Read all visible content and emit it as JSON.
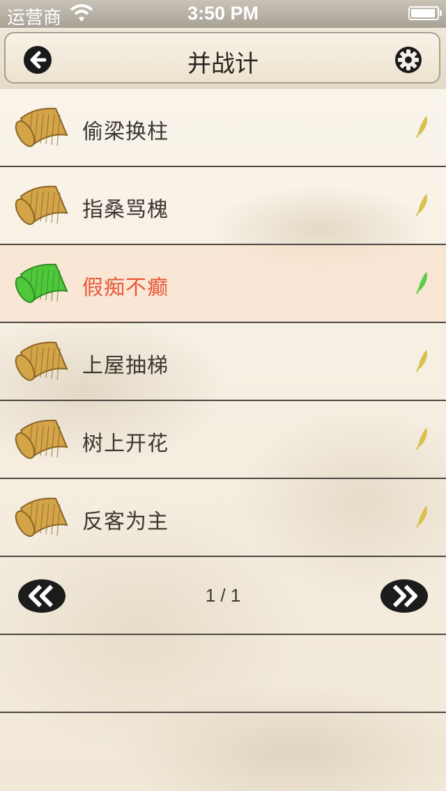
{
  "status_bar": {
    "carrier": "运营商",
    "time": "3:50 PM"
  },
  "nav": {
    "title": "并战计"
  },
  "icons": {
    "back": "back-arrow-icon",
    "settings": "gear-icon",
    "item": "bamboo-scroll-icon",
    "item_marker": "leaf-icon",
    "prev": "double-chevron-left-icon",
    "next": "double-chevron-right-icon"
  },
  "colors": {
    "selected_text": "#e8583a",
    "normal_text": "#3b3632",
    "scroll_gold": "#d3a448",
    "scroll_green": "#4fc83c",
    "leaf_gold": "#d8c04a",
    "leaf_green": "#5ccc4a"
  },
  "items": [
    {
      "label": "偷梁换柱",
      "selected": false
    },
    {
      "label": "指桑骂槐",
      "selected": false
    },
    {
      "label": "假痴不癫",
      "selected": true
    },
    {
      "label": "上屋抽梯",
      "selected": false
    },
    {
      "label": "树上开花",
      "selected": false
    },
    {
      "label": "反客为主",
      "selected": false
    }
  ],
  "pager": {
    "indicator": "1 / 1"
  }
}
